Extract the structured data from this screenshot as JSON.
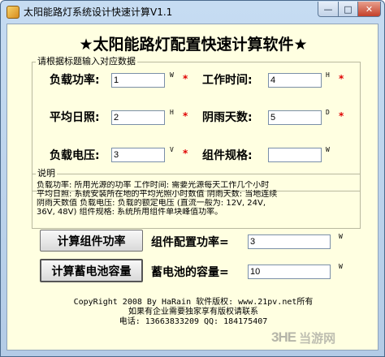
{
  "window": {
    "title": "太阳能路灯系统设计快速计算V1.1",
    "minimize_glyph": "—",
    "maximize_glyph": "□",
    "close_glyph": "✕"
  },
  "main_title": "★太阳能路灯配置快速计算软件★",
  "input_group": {
    "legend": "请根据标题输入对应数据",
    "fields": [
      {
        "label": "负载功率:",
        "value": "1",
        "unit": "W",
        "required": "*"
      },
      {
        "label": "工作时间:",
        "value": "4",
        "unit": "H",
        "required": "*"
      },
      {
        "label": "平均日照:",
        "value": "2",
        "unit": "H",
        "required": "*"
      },
      {
        "label": "阴雨天数:",
        "value": "5",
        "unit": "D",
        "required": "*"
      },
      {
        "label": "负载电压:",
        "value": "3",
        "unit": "V",
        "required": "*"
      },
      {
        "label": "组件规格:",
        "value": "",
        "unit": "W",
        "required": ""
      }
    ]
  },
  "description": {
    "legend": "说明",
    "lines": [
      "负载功率: 所用光源的功率     工作时间: 需要光源每天工作几个小时",
      "平均日照: 系统安装所在地的平均光照小时数值   阴雨天数: 当地连续",
      "阴雨天数值   负载电压: 负载的额定电压 (直流一般为: 12V, 24V,",
      "36V, 48V)   组件规格: 系统所用组件单块峰值功率。"
    ]
  },
  "actions": {
    "calc_panel_label": "计算组件功率",
    "calc_battery_label": "计算蓄电池容量"
  },
  "results": {
    "panel_label": "组件配置功率=",
    "panel_value": "3",
    "panel_unit": "W",
    "battery_label": "蓄电池的容量=",
    "battery_value": "10",
    "battery_unit": "W"
  },
  "footer": {
    "line1": "CopyRight 2008 By HaRain  软件版权: www.21pv.net所有",
    "line2": "如果有企业需要独家享有版权请联系",
    "line3": "电话: 13663833209  QQ: 184175407"
  },
  "watermark": {
    "logo": "3HE",
    "text": "当游网"
  }
}
